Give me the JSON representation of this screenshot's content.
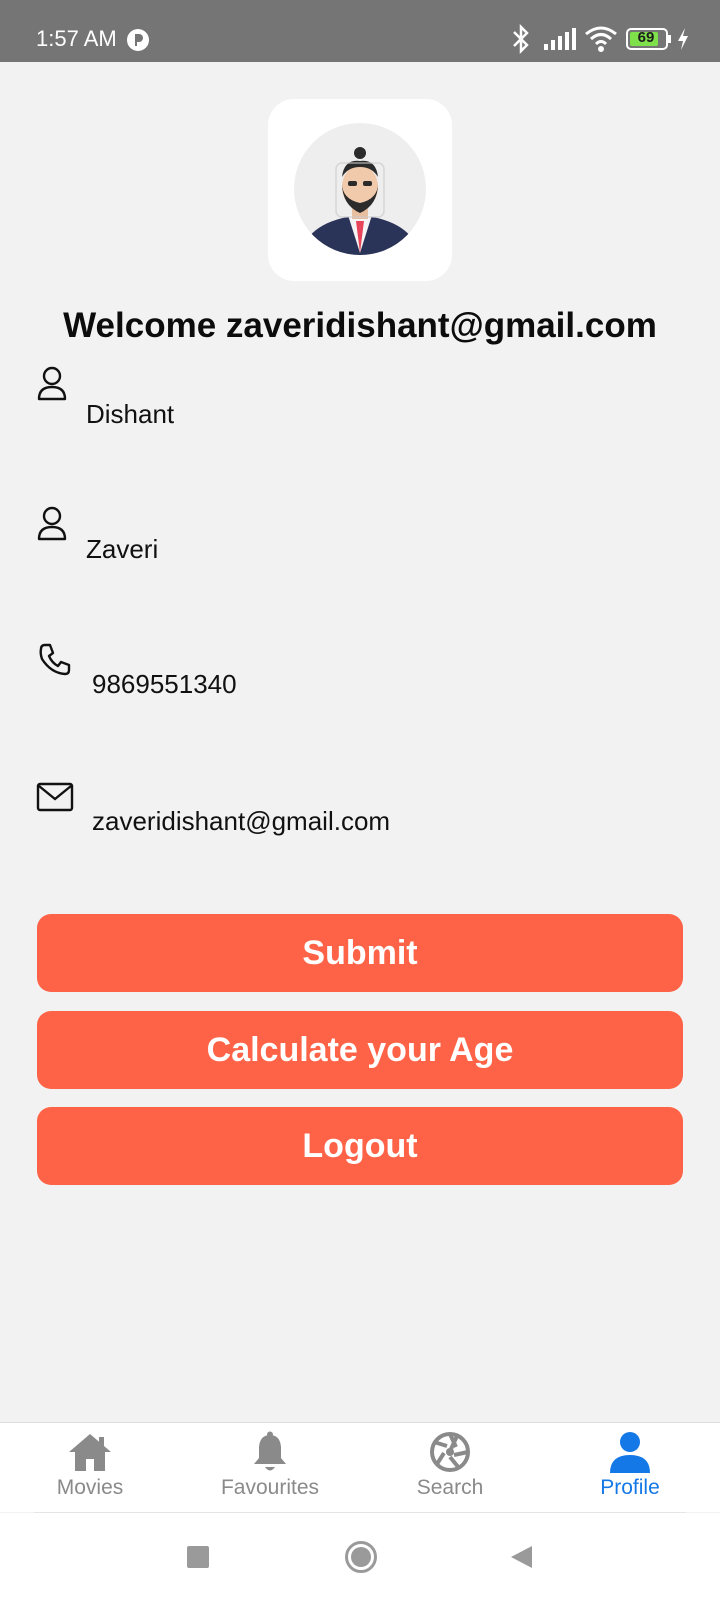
{
  "status_bar": {
    "time": "1:57 AM",
    "battery": "69"
  },
  "profile": {
    "welcome": "Welcome zaveridishant@gmail.com",
    "first_name": "Dishant",
    "last_name": "Zaveri",
    "phone": "9869551340",
    "email": "zaveridishant@gmail.com"
  },
  "buttons": {
    "submit": "Submit",
    "calculate_age": "Calculate your Age",
    "logout": "Logout"
  },
  "bottom_nav": {
    "items": [
      {
        "label": "Movies",
        "icon": "home-icon",
        "active": false
      },
      {
        "label": "Favourites",
        "icon": "bell-icon",
        "active": false
      },
      {
        "label": "Search",
        "icon": "aperture-icon",
        "active": false
      },
      {
        "label": "Profile",
        "icon": "person-icon",
        "active": true
      }
    ],
    "active_color": "#1479e6",
    "inactive_color": "#8a8a8a"
  },
  "colors": {
    "accent": "#ff6347",
    "background": "#f2f2f2",
    "status_bar": "#757575"
  }
}
